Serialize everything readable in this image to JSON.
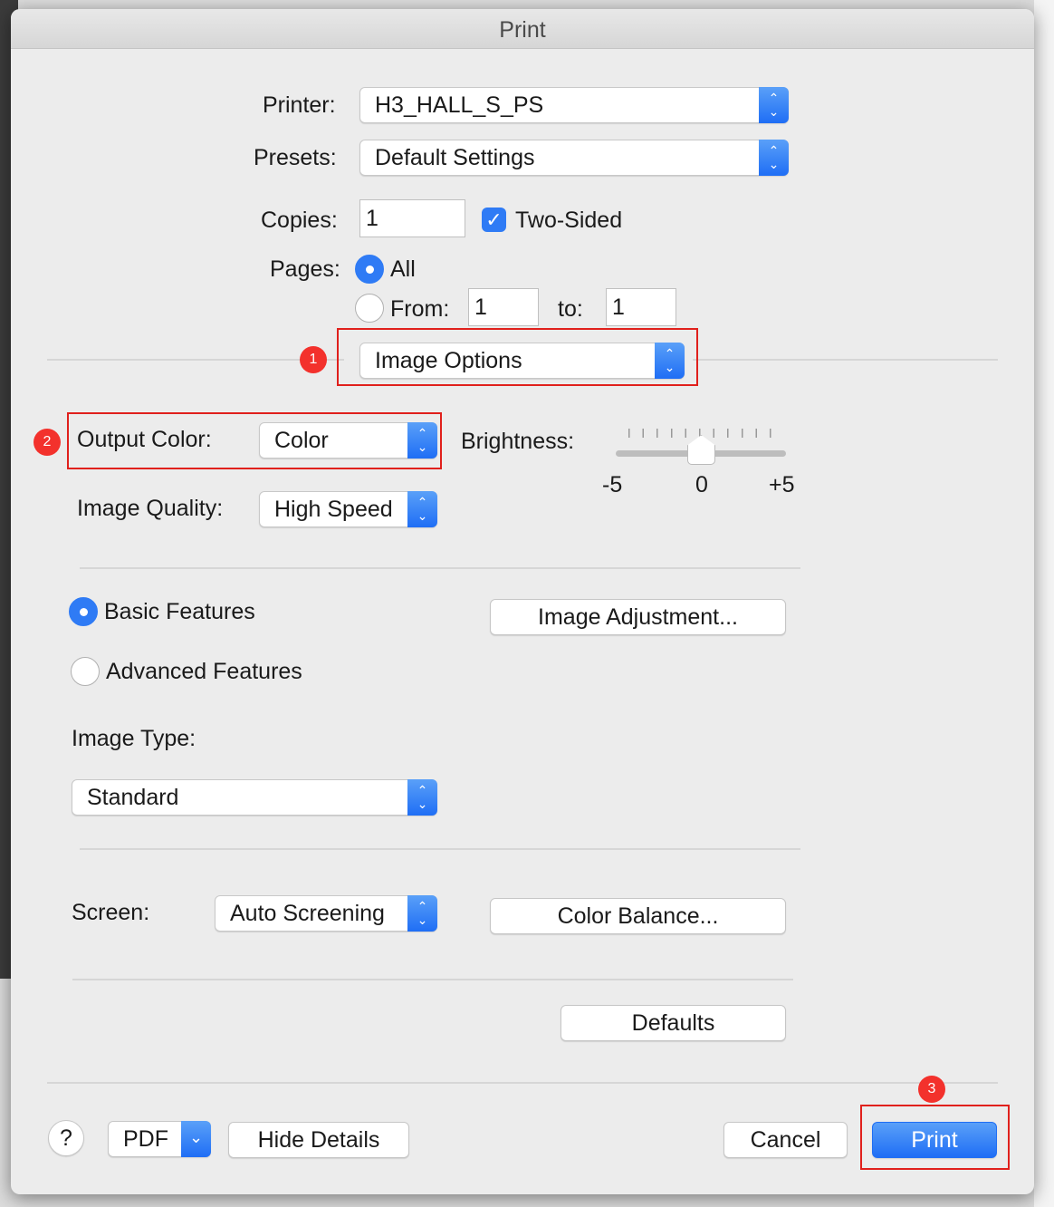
{
  "title": "Print",
  "printer": {
    "label": "Printer:",
    "value": "H3_HALL_S_PS"
  },
  "presets": {
    "label": "Presets:",
    "value": "Default Settings"
  },
  "copies": {
    "label": "Copies:",
    "value": "1",
    "two_sided_label": "Two-Sided",
    "two_sided_checked": true
  },
  "pages": {
    "label": "Pages:",
    "all_label": "All",
    "from_label": "From:",
    "from_value": "1",
    "to_label": "to:",
    "to_value": "1",
    "selected": "All"
  },
  "section_menu": {
    "value": "Image Options"
  },
  "output_color": {
    "label": "Output Color:",
    "value": "Color"
  },
  "brightness": {
    "label": "Brightness:",
    "min_label": "-5",
    "mid_label": "0",
    "max_label": "+5",
    "value": 0
  },
  "image_quality": {
    "label": "Image Quality:",
    "value": "High Speed"
  },
  "features": {
    "basic_label": "Basic Features",
    "advanced_label": "Advanced Features",
    "selected": "Basic Features"
  },
  "image_adjustment_label": "Image Adjustment...",
  "image_type": {
    "label": "Image Type:",
    "value": "Standard"
  },
  "screen": {
    "label": "Screen:",
    "value": "Auto Screening"
  },
  "color_balance_label": "Color Balance...",
  "defaults_label": "Defaults",
  "footer": {
    "help": "?",
    "pdf": "PDF",
    "hide_details": "Hide Details",
    "cancel": "Cancel",
    "print": "Print"
  },
  "annotations": [
    "1",
    "2",
    "3"
  ],
  "colors": {
    "accent": "#2f7bf5",
    "highlight": "#e0201c"
  }
}
